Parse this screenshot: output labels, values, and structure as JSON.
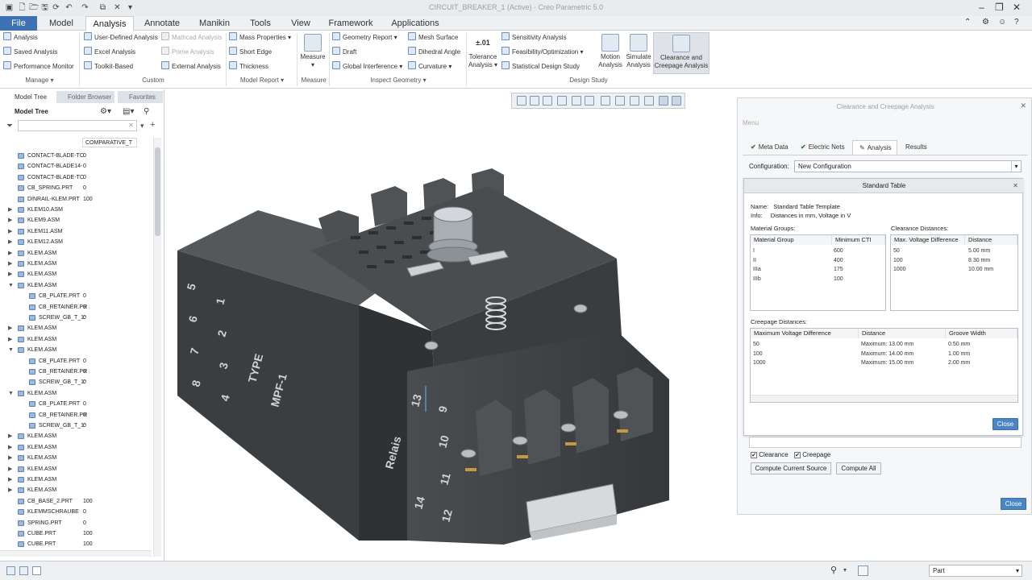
{
  "window": {
    "title": "CIRCUIT_BREAKER_1 (Active) - Creo Parametric 5.0"
  },
  "menu": {
    "tabs": [
      "File",
      "Model",
      "Analysis",
      "Annotate",
      "Manikin",
      "Tools",
      "View",
      "Framework",
      "Applications"
    ]
  },
  "ribbon": {
    "manage": {
      "items": [
        "Analysis",
        "Saved Analysis",
        "Performance Monitor"
      ],
      "label": "Manage"
    },
    "custom": {
      "items": [
        "User-Defined Analysis",
        "Mathcad Analysis",
        "Excel Analysis",
        "Prime Analysis",
        "Toolkit-Based",
        "External Analysis"
      ],
      "label": "Custom"
    },
    "model_report": {
      "items": [
        "Mass Properties",
        "Short Edge",
        "Thickness"
      ],
      "label": "Model Report"
    },
    "measure": {
      "big": "Measure",
      "label": "Measure"
    },
    "inspect": {
      "items": [
        "Geometry Report",
        "Draft",
        "Global Interference",
        "Mesh Surface",
        "Dihedral Angle",
        "Curvature"
      ],
      "label": "Inspect Geometry"
    },
    "design_study": {
      "tolerance": "Tolerance Analysis",
      "items": [
        "Sensitivity Analysis",
        "Feasibility/Optimization",
        "Statistical Design Study"
      ],
      "motion": "Motion Analysis",
      "simulate": "Simulate Analysis",
      "clearance": "Clearance and Creepage Analysis",
      "label": "Design Study"
    }
  },
  "left_panel": {
    "tabs": [
      "Model Tree",
      "Folder Browser",
      "Favorites"
    ],
    "header": "Model Tree",
    "column": "COMPARATIVE_T",
    "rows": [
      {
        "name": "CONTACT-BLADE-TC",
        "value": "0",
        "indent": 1,
        "exp": ""
      },
      {
        "name": "CONTACT-BLADE14-",
        "value": "0",
        "indent": 1,
        "exp": ""
      },
      {
        "name": "CONTACT-BLADE-TC",
        "value": "0",
        "indent": 1,
        "exp": ""
      },
      {
        "name": "CB_SPRING.PRT",
        "value": "0",
        "indent": 1,
        "exp": ""
      },
      {
        "name": "DINRAIL-KLEM.PRT",
        "value": "100",
        "indent": 1,
        "exp": ""
      },
      {
        "name": "KLEM10.ASM",
        "value": "",
        "indent": 1,
        "exp": "▶"
      },
      {
        "name": "KLEM9.ASM",
        "value": "",
        "indent": 1,
        "exp": "▶"
      },
      {
        "name": "KLEM11.ASM",
        "value": "",
        "indent": 1,
        "exp": "▶"
      },
      {
        "name": "KLEM12.ASM",
        "value": "",
        "indent": 1,
        "exp": "▶"
      },
      {
        "name": "KLEM.ASM",
        "value": "",
        "indent": 1,
        "exp": "▶"
      },
      {
        "name": "KLEM.ASM",
        "value": "",
        "indent": 1,
        "exp": "▶"
      },
      {
        "name": "KLEM.ASM",
        "value": "",
        "indent": 1,
        "exp": "▶"
      },
      {
        "name": "KLEM.ASM",
        "value": "",
        "indent": 1,
        "exp": "▼"
      },
      {
        "name": "CB_PLATE.PRT",
        "value": "0",
        "indent": 2,
        "exp": ""
      },
      {
        "name": "CB_RETAINER.PR",
        "value": "0",
        "indent": 2,
        "exp": ""
      },
      {
        "name": "SCREW_GB_T_1:",
        "value": "0",
        "indent": 2,
        "exp": ""
      },
      {
        "name": "KLEM.ASM",
        "value": "",
        "indent": 1,
        "exp": "▶"
      },
      {
        "name": "KLEM.ASM",
        "value": "",
        "indent": 1,
        "exp": "▶"
      },
      {
        "name": "KLEM.ASM",
        "value": "",
        "indent": 1,
        "exp": "▼"
      },
      {
        "name": "CB_PLATE.PRT",
        "value": "0",
        "indent": 2,
        "exp": ""
      },
      {
        "name": "CB_RETAINER.PR",
        "value": "0",
        "indent": 2,
        "exp": ""
      },
      {
        "name": "SCREW_GB_T_1:",
        "value": "0",
        "indent": 2,
        "exp": ""
      },
      {
        "name": "KLEM.ASM",
        "value": "",
        "indent": 1,
        "exp": "▼"
      },
      {
        "name": "CB_PLATE.PRT",
        "value": "0",
        "indent": 2,
        "exp": ""
      },
      {
        "name": "CB_RETAINER.PR",
        "value": "0",
        "indent": 2,
        "exp": ""
      },
      {
        "name": "SCREW_GB_T_1:",
        "value": "0",
        "indent": 2,
        "exp": ""
      },
      {
        "name": "KLEM.ASM",
        "value": "",
        "indent": 1,
        "exp": "▶"
      },
      {
        "name": "KLEM.ASM",
        "value": "",
        "indent": 1,
        "exp": "▶"
      },
      {
        "name": "KLEM.ASM",
        "value": "",
        "indent": 1,
        "exp": "▶"
      },
      {
        "name": "KLEM.ASM",
        "value": "",
        "indent": 1,
        "exp": "▶"
      },
      {
        "name": "KLEM.ASM",
        "value": "",
        "indent": 1,
        "exp": "▶"
      },
      {
        "name": "KLEM.ASM",
        "value": "",
        "indent": 1,
        "exp": "▶"
      },
      {
        "name": "CB_BASE_2.PRT",
        "value": "100",
        "indent": 1,
        "exp": ""
      },
      {
        "name": "KLEMMSCHRAUBE",
        "value": "0",
        "indent": 1,
        "exp": ""
      },
      {
        "name": "SPRING.PRT",
        "value": "0",
        "indent": 1,
        "exp": ""
      },
      {
        "name": "CUBE.PRT",
        "value": "100",
        "indent": 1,
        "exp": ""
      },
      {
        "name": "CUBE.PRT",
        "value": "100",
        "indent": 1,
        "exp": ""
      }
    ]
  },
  "model": {
    "labels": [
      "5",
      "6",
      "7",
      "8",
      "1",
      "2",
      "3",
      "4",
      "TYPE",
      "MPF-1",
      "13",
      "9",
      "10",
      "11",
      "12",
      "14",
      "Relais"
    ]
  },
  "dialog": {
    "title": "Clearance and Creepage Analysis",
    "menu": "Menu",
    "tabs": [
      "Meta Data",
      "Electric Nets",
      "Analysis",
      "Results"
    ],
    "config_label": "Configuration:",
    "config_value": "New Configuration",
    "clearance": "Clearance",
    "creepage": "Creepage",
    "compute_current": "Compute Current Source",
    "compute_all": "Compute All",
    "close": "Close"
  },
  "std_table": {
    "title": "Standard Table",
    "name_label": "Name:",
    "name": "Standard Table Template",
    "info_label": "Info:",
    "info": "Distances in mm, Voltage in V",
    "material_groups_label": "Material Groups:",
    "material_headers": [
      "Material Group",
      "Minimum CTI"
    ],
    "material_rows": [
      [
        "I",
        "600"
      ],
      [
        "II",
        "400"
      ],
      [
        "IIIa",
        "175"
      ],
      [
        "IIIb",
        "100"
      ]
    ],
    "clearance_label": "Clearance Distances:",
    "clearance_headers": [
      "Max. Voltage Difference",
      "Distance"
    ],
    "clearance_rows": [
      [
        "50",
        "5.00 mm"
      ],
      [
        "100",
        "8.30 mm"
      ],
      [
        "1000",
        "10.00 mm"
      ]
    ],
    "creepage_label": "Creepage Distances:",
    "creepage_headers": [
      "Maximum Voltage Difference",
      "Distance",
      "Groove Width"
    ],
    "creepage_rows": [
      [
        "50",
        "Maximum: 13.00 mm",
        "0.50 mm"
      ],
      [
        "100",
        "Maximum: 14.00 mm",
        "1.00 mm"
      ],
      [
        "1000",
        "Maximum: 15.00 mm",
        "2.00 mm"
      ]
    ],
    "close": "Close"
  },
  "status": {
    "filter": "Part"
  }
}
